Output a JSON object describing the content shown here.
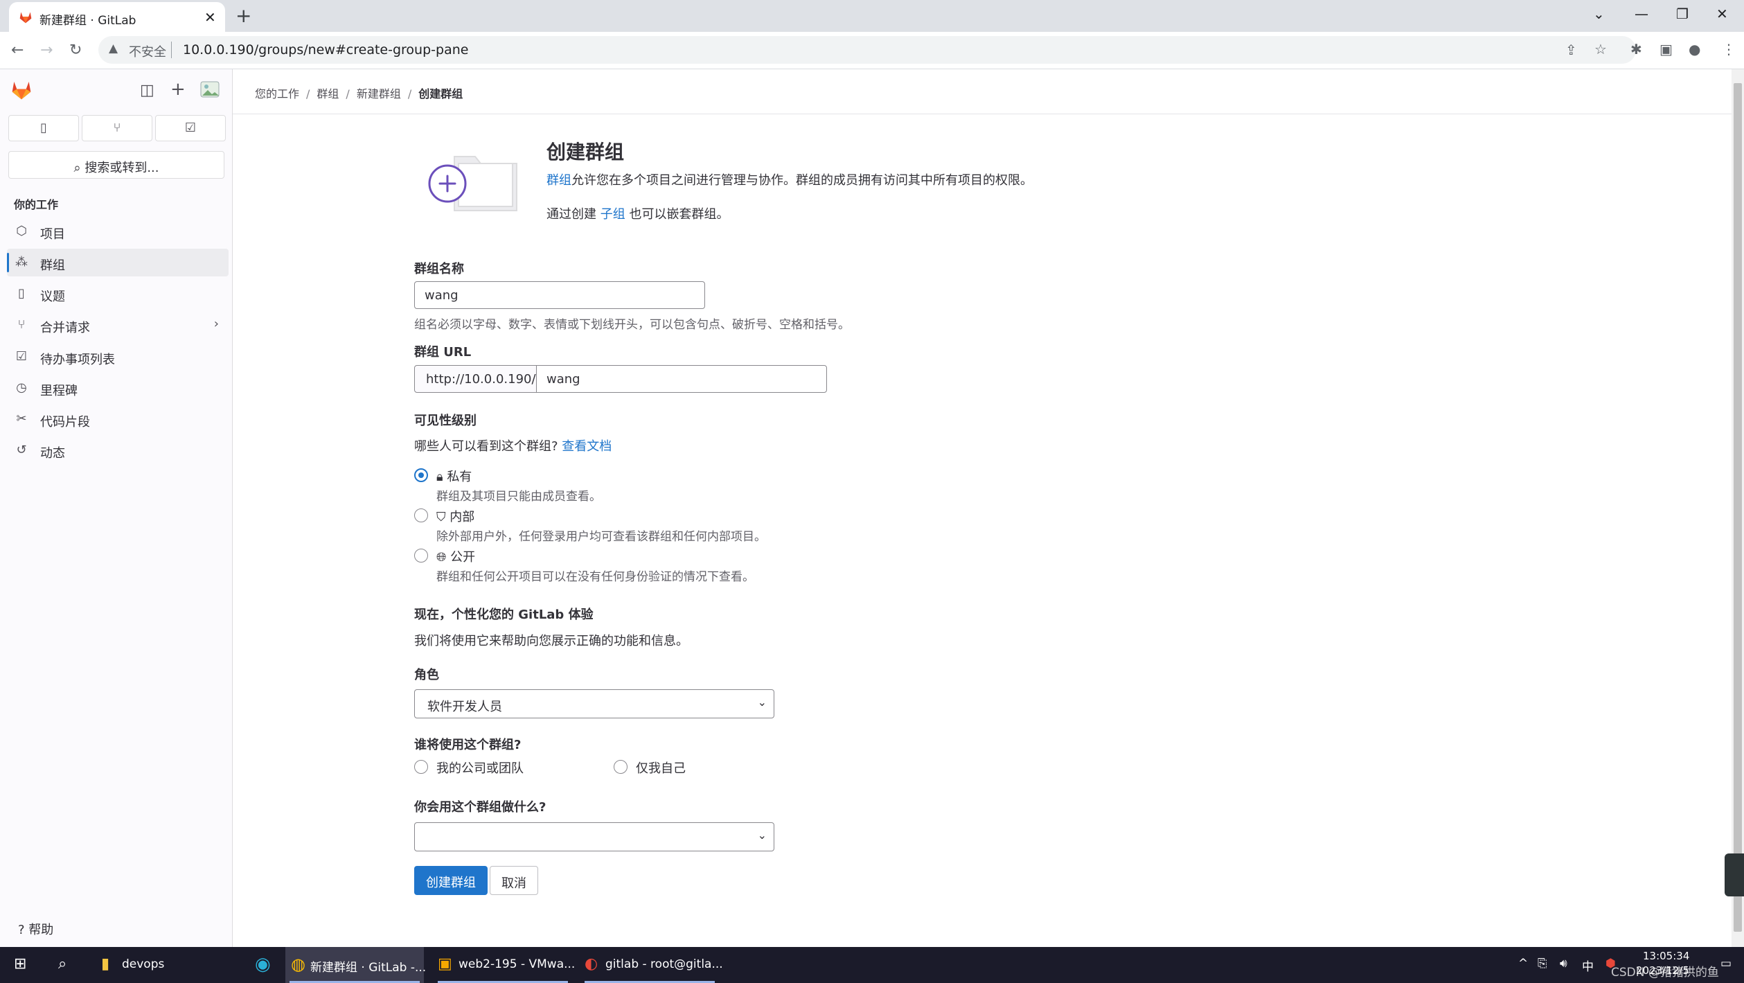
{
  "browser": {
    "tab_title": "新建群组 · GitLab",
    "insecure_label": "不安全",
    "url": "10.0.0.190/groups/new#create-group-pane"
  },
  "sidebar": {
    "search_label": "搜索或转到...",
    "section_heading": "你的工作",
    "items": [
      {
        "label": "项目",
        "icon": "project-icon"
      },
      {
        "label": "群组",
        "icon": "group-icon"
      },
      {
        "label": "议题",
        "icon": "issues-icon"
      },
      {
        "label": "合并请求",
        "icon": "merge-request-icon"
      },
      {
        "label": "待办事项列表",
        "icon": "todo-icon"
      },
      {
        "label": "里程碑",
        "icon": "milestone-icon"
      },
      {
        "label": "代码片段",
        "icon": "snippet-icon"
      },
      {
        "label": "动态",
        "icon": "activity-icon"
      }
    ],
    "active_item": "群组",
    "help_label": "帮助"
  },
  "breadcrumb": [
    "您的工作",
    "群组",
    "新建群组",
    "创建群组"
  ],
  "header": {
    "title": "创建群组",
    "desc_link": "群组",
    "desc_rest": "允许您在多个项目之间进行管理与协作。群组的成员拥有访问其中所有项目的权限。",
    "nest_prefix": "通过创建",
    "nest_link": "子组",
    "nest_suffix": "也可以嵌套群组。"
  },
  "form": {
    "name_label": "群组名称",
    "name_value": "wang",
    "name_help": "组名必须以字母、数字、表情或下划线开头，可以包含句点、破折号、空格和括号。",
    "url_label": "群组 URL",
    "url_prefix": "http://10.0.0.190/",
    "url_value": "wang",
    "visibility_label": "可见性级别",
    "visibility_question": "哪些人可以看到这个群组?",
    "visibility_doc_link": "查看文档",
    "visibility_options": [
      {
        "label": "私有",
        "desc": "群组及其项目只能由成员查看。",
        "checked": true
      },
      {
        "label": "内部",
        "desc": "除外部用户外，任何登录用户均可查看该群组和任何内部项目。",
        "checked": false
      },
      {
        "label": "公开",
        "desc": "群组和任何公开项目可以在没有任何身份验证的情况下查看。",
        "checked": false
      }
    ],
    "personalize_heading": "现在，个性化您的 GitLab 体验",
    "personalize_desc": "我们将使用它来帮助向您展示正确的功能和信息。",
    "role_label": "角色",
    "role_value": "软件开发人员",
    "who_label": "谁将使用这个群组?",
    "who_options": [
      "我的公司或团队",
      "仅我自己"
    ],
    "purpose_label": "你会用这个群组做什么?",
    "purpose_value": "",
    "create_button": "创建群组",
    "cancel_button": "取消"
  },
  "taskbar": {
    "apps": [
      {
        "label": "devops",
        "active": false
      },
      {
        "label": "新建群组 · GitLab -...",
        "active": true
      },
      {
        "label": "web2-195 - VMwa...",
        "active": false
      },
      {
        "label": "gitlab - root@gitla...",
        "active": false
      }
    ],
    "ime": "中",
    "time": "13:05:34",
    "date": "2023/12/5",
    "watermark": "CSDN @猪猪拱的鱼"
  },
  "colors": {
    "accent": "#1f75cb",
    "gitlab_orange": "#e24329",
    "illustration_purple": "#6b4fbb"
  }
}
